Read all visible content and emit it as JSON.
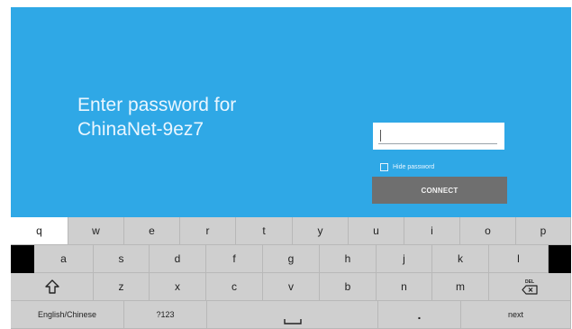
{
  "prompt": {
    "line1": "Enter password for",
    "line2": "ChinaNet-9ez7"
  },
  "password": {
    "value": "",
    "placeholder": ""
  },
  "hide_password": {
    "label": "Hide password",
    "checked": false
  },
  "connect": {
    "label": "CONNECT"
  },
  "keyboard": {
    "row1": [
      "q",
      "w",
      "e",
      "r",
      "t",
      "y",
      "u",
      "i",
      "o",
      "p"
    ],
    "row2": [
      "a",
      "s",
      "d",
      "f",
      "g",
      "h",
      "j",
      "k",
      "l"
    ],
    "row3": [
      "z",
      "x",
      "c",
      "v",
      "b",
      "n",
      "m"
    ],
    "del_label": "DEL",
    "lang_label": "English/Chinese",
    "symbols_label": "?123",
    "period_label": ".",
    "next_label": "next",
    "shift_icon": "shift-arrow-icon",
    "backspace_icon": "backspace-icon",
    "space_icon": "space-bar-icon"
  },
  "colors": {
    "panel": "#2fa8e6",
    "connect": "#6f6f6f",
    "keyboard": "#cfcfcf",
    "active_key": "#ffffff"
  }
}
